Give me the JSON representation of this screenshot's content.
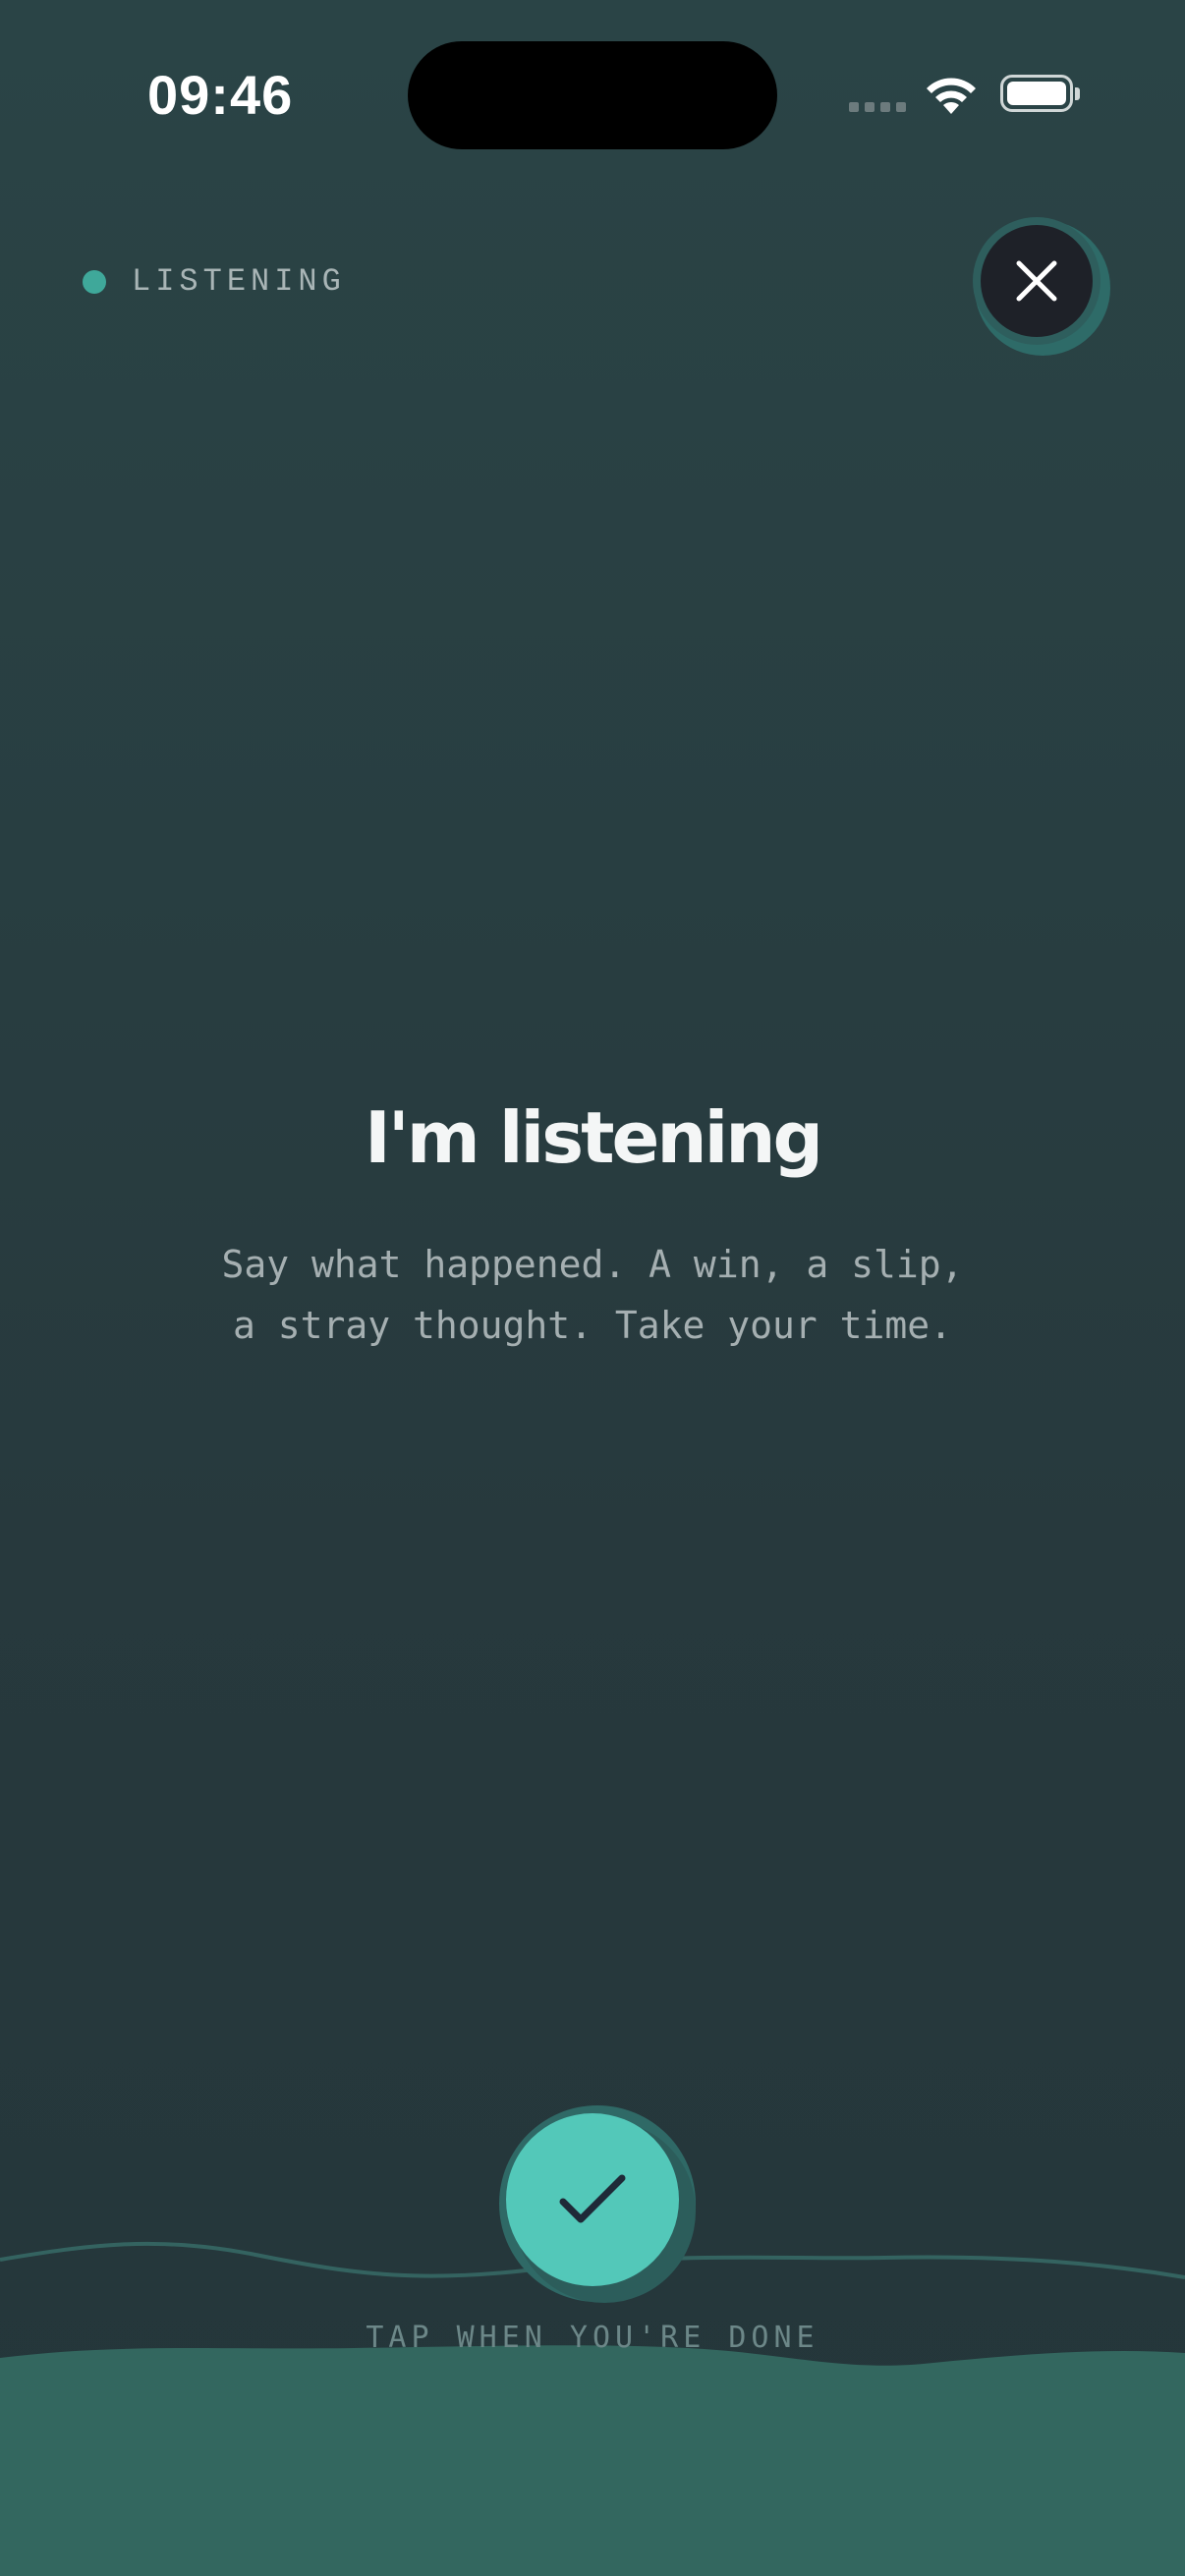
{
  "status_bar": {
    "time": "09:46",
    "icons": [
      "cellular-signal-icon",
      "wifi-icon",
      "battery-icon"
    ]
  },
  "indicator": {
    "label": "LISTENING",
    "dot_color": "#3fa89a"
  },
  "close_button": {
    "icon": "close-icon"
  },
  "main": {
    "title": "I'm listening",
    "subtitle_line1": "Say what happened. A win, a slip,",
    "subtitle_line2": "a stray thought. Take your time."
  },
  "done": {
    "icon": "checkmark-icon",
    "hint": "TAP WHEN YOU'RE DONE",
    "accent": "#53c8b9"
  },
  "colors": {
    "background": "#27393d",
    "accent": "#53c8b9",
    "wave": "#33675f"
  }
}
